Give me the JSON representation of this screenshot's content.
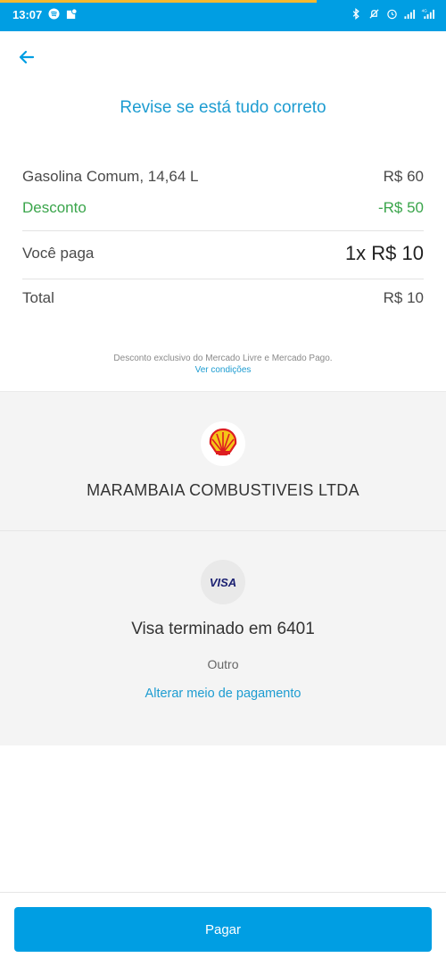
{
  "status_bar": {
    "time": "13:07",
    "left_icons": [
      "spotify-icon",
      "maps-icon"
    ],
    "right_icons": [
      "bluetooth-icon",
      "mute-icon",
      "alarm-icon",
      "signal-icon",
      "signal-4g-icon"
    ],
    "bg_color": "#009ee3"
  },
  "header": {
    "title": "Revise se está tudo correto"
  },
  "summary": {
    "item_label": "Gasolina Comum, 14,64 L",
    "item_value": "R$ 60",
    "discount_label": "Desconto",
    "discount_value": "-R$ 50",
    "you_pay_label": "Você paga",
    "you_pay_value": "1x R$ 10",
    "total_label": "Total",
    "total_value": "R$ 10"
  },
  "disclaimer": {
    "text": "Desconto exclusivo do Mercado Livre e Mercado Pago.",
    "link": "Ver condições"
  },
  "merchant": {
    "name": "MARAMBAIA COMBUSTIVEIS LTDA",
    "logo": "shell-logo-icon"
  },
  "payment": {
    "brand": "VISA",
    "card_text": "Visa terminado em 6401",
    "type": "Outro",
    "change_link": "Alterar meio de pagamento"
  },
  "action": {
    "pay_label": "Pagar"
  },
  "colors": {
    "accent": "#009ee3",
    "link": "#1d9cd1",
    "discount": "#3aa54b"
  }
}
